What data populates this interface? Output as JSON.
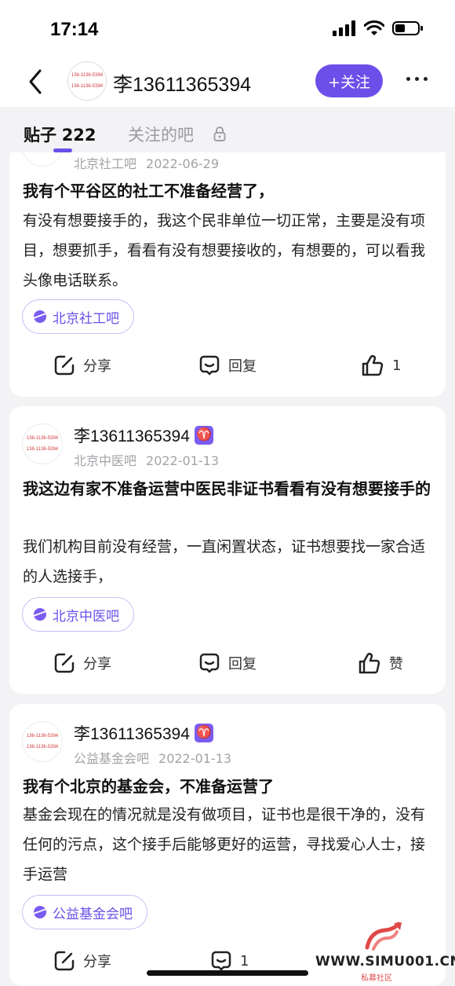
{
  "status": {
    "time": "17:14"
  },
  "nav": {
    "title": "李13611365394",
    "follow_label": "+关注",
    "avatar_lines": [
      "136-1136-5394",
      "136-1136-5394"
    ]
  },
  "tabs": {
    "posts_label": "贴子",
    "posts_count": "222",
    "followed_label": "关注的吧"
  },
  "posts": [
    {
      "author": "",
      "bar": "北京社工吧",
      "date": "2022-06-29",
      "title": "我有个平谷区的社工不准备经营了，",
      "body": "有没有想要接手的，我这个民非单位一切正常，主要是没有项目，想要抓手，看看有没有想要接收的，有想要的，可以看我头像电话联系。",
      "tag": "北京社工吧",
      "share": "分享",
      "reply": "回复",
      "like": "1"
    },
    {
      "author": "李13611365394",
      "zodiac": "♈",
      "bar": "北京中医吧",
      "date": "2022-01-13",
      "title": "我这边有家不准备运营中医民非证书看看有没有想要接手的",
      "body": "我们机构目前没有经营，一直闲置状态，证书想要找一家合适的人选接手，",
      "tag": "北京中医吧",
      "share": "分享",
      "reply": "回复",
      "like": "赞"
    },
    {
      "author": "李13611365394",
      "zodiac": "♈",
      "bar": "公益基金会吧",
      "date": "2022-01-13",
      "title": "我有个北京的基金会，不准备运营了",
      "body": "基金会现在的情况就是没有做项目，证书也是很干净的，没有任何的污点，这个接手后能够更好的运营，寻找爱心人士，接手运营",
      "tag": "公益基金会吧",
      "share": "分享",
      "reply": "1"
    }
  ],
  "watermark": {
    "text": "WWW.SIMU001.CN",
    "sub": "私募社区"
  },
  "colors": {
    "accent": "#6b4fe8",
    "background": "#f3f3f5",
    "card": "#ffffff"
  }
}
